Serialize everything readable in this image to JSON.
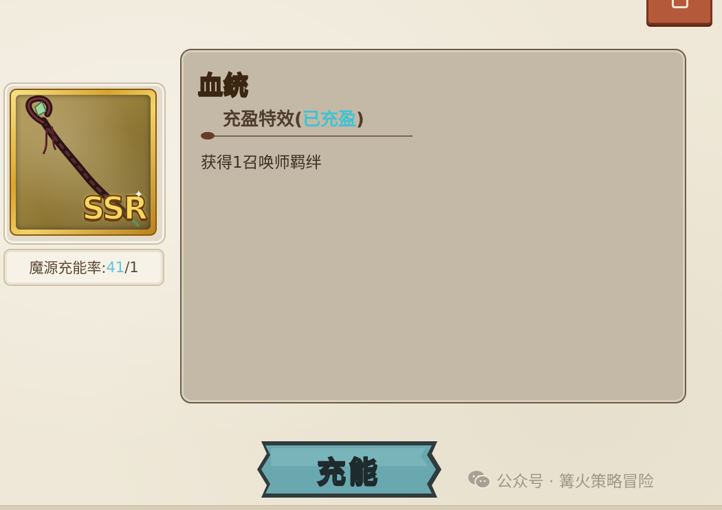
{
  "item": {
    "rarity": "SSR",
    "charge_rate_label": "魔源充能率: ",
    "charge_rate_value": "41",
    "charge_rate_max": "/1"
  },
  "panel": {
    "title": "血统",
    "effect_prefix": "充盈特效(",
    "effect_status": "已充盈",
    "effect_suffix": ")",
    "description": "获得1召唤师羁绊"
  },
  "button": {
    "charge_label": "充能"
  },
  "watermark": {
    "text": "公众号 · 篝火策略冒险"
  },
  "colors": {
    "title_yellow": "#f6cf46",
    "status_cyan": "#3fc3d4",
    "button_teal": "#5e9ea6",
    "panel_bg": "#c3b9a6"
  }
}
